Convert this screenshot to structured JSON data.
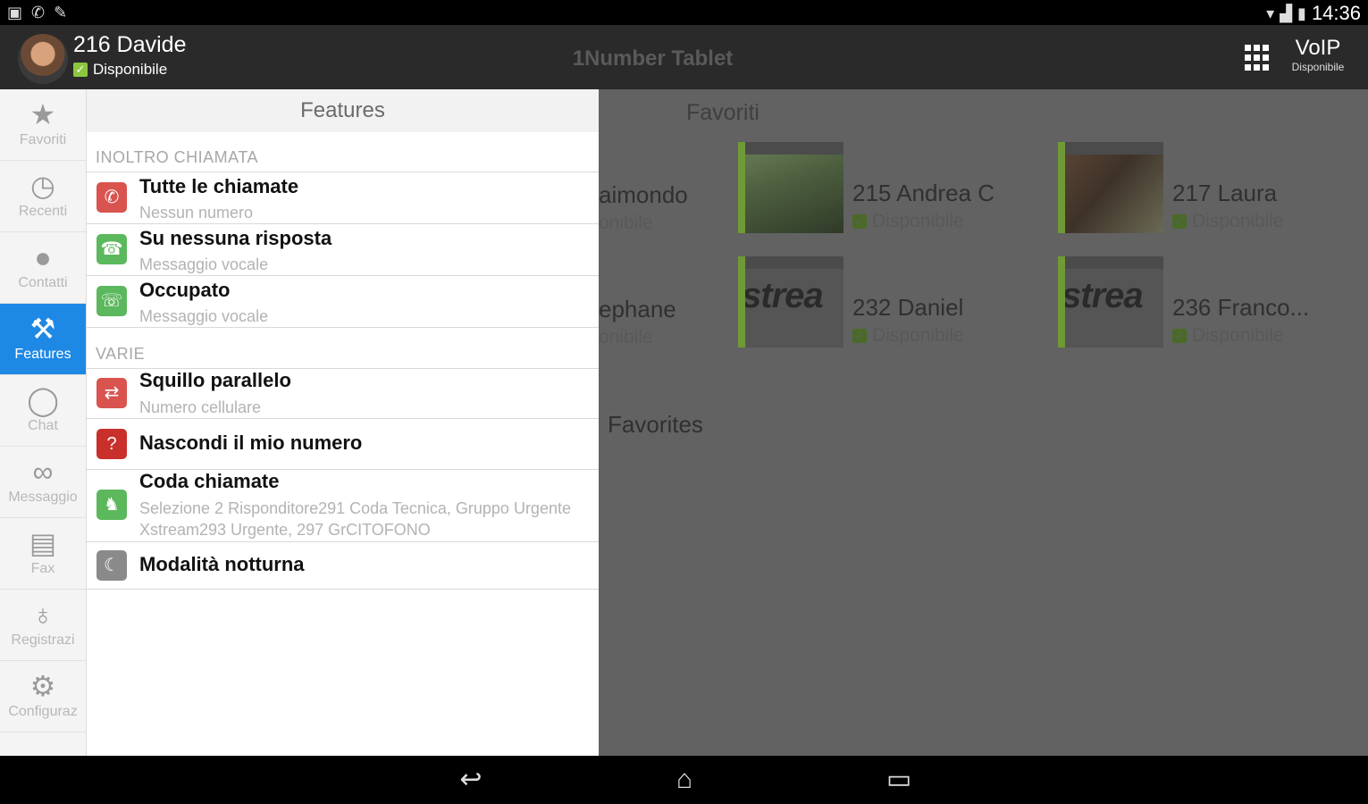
{
  "status_bar": {
    "time": "14:36",
    "left_icons": [
      "image-icon",
      "phone-icon",
      "pencil-icon"
    ],
    "right_icons": [
      "wifi-icon",
      "signal-icon",
      "battery-icon"
    ]
  },
  "action_bar": {
    "user_name": "216 Davide",
    "user_status": "Disponibile",
    "app_title": "1Number Tablet",
    "voip_label": "VoIP",
    "voip_status": "Disponibile"
  },
  "sidebar": {
    "items": [
      {
        "label": "Favoriti",
        "icon": "star-icon"
      },
      {
        "label": "Recenti",
        "icon": "clock-icon"
      },
      {
        "label": "Contatti",
        "icon": "person-icon"
      },
      {
        "label": "Features",
        "icon": "wrench-icon",
        "active": true
      },
      {
        "label": "Chat",
        "icon": "chat-icon"
      },
      {
        "label": "Messaggio",
        "icon": "voicemail-icon"
      },
      {
        "label": "Fax",
        "icon": "printer-icon"
      },
      {
        "label": "Registrazi",
        "icon": "microphone-icon"
      },
      {
        "label": "Configuraz",
        "icon": "gear-icon"
      }
    ]
  },
  "panel": {
    "title": "Features",
    "section_forward": "INOLTRO CHIAMATA",
    "section_misc": "VARIE",
    "features": [
      {
        "title": "Tutte le chiamate",
        "subtitle": "Nessun numero",
        "icon": "call-forward-icon"
      },
      {
        "title": "Su nessuna risposta",
        "subtitle": "Messaggio vocale",
        "icon": "no-answer-icon"
      },
      {
        "title": "Occupato",
        "subtitle": "Messaggio vocale",
        "icon": "busy-icon"
      },
      {
        "title": "Squillo parallelo",
        "subtitle": "Numero cellulare",
        "icon": "parallel-ring-icon"
      },
      {
        "title": "Nascondi il mio numero",
        "subtitle": "",
        "icon": "hide-number-icon"
      },
      {
        "title": "Coda chiamate",
        "subtitle": "Selezione 2 Risponditore291 Coda Tecnica, Gruppo Urgente Xstream293 Urgente, 297 GrCITOFONO",
        "icon": "call-queue-icon"
      },
      {
        "title": "Modalità notturna",
        "subtitle": "",
        "icon": "night-mode-icon"
      }
    ]
  },
  "main": {
    "header": "Favoriti",
    "favorites_label": "Favorites",
    "partial": [
      {
        "name": "aimondo",
        "status": "onibile"
      },
      {
        "name": "ephane",
        "status": "onibile"
      }
    ],
    "contacts": [
      {
        "name": "215 Andrea C",
        "status": "Disponibile"
      },
      {
        "name": "217 Laura",
        "status": "Disponibile"
      },
      {
        "name": "232 Daniel",
        "status": "Disponibile",
        "thumb_text": "strea"
      },
      {
        "name": "236 Franco...",
        "status": "Disponibile",
        "thumb_text": "strea"
      }
    ]
  },
  "colors": {
    "accent": "#1e88e5",
    "available_green": "#8cc63f"
  }
}
